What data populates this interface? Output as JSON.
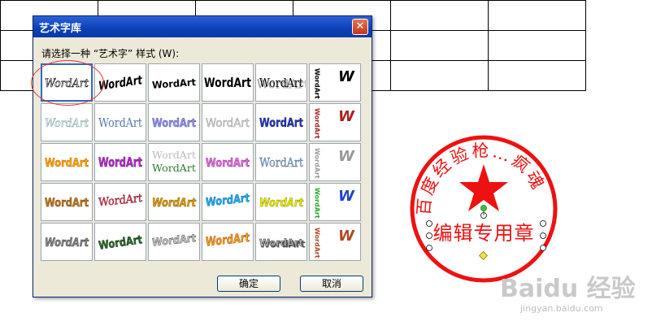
{
  "dialog": {
    "title": "艺术字库",
    "close_glyph": "✕",
    "prompt": "请选择一种 “艺术字” 样式 (W):",
    "ok_label": "确定",
    "cancel_label": "取消"
  },
  "gallery": {
    "sample_text": "WordArt",
    "vertical_sample": "WordArt",
    "selected_index": 0
  },
  "stamp": {
    "arc_text": "百度经验枪…",
    "arc_text2": "疯魂",
    "bottom_text": "编辑专用章",
    "color": "#ee1111"
  },
  "watermark": {
    "brand": "Baidu 经验",
    "url": "jingyan.baidu.com"
  }
}
